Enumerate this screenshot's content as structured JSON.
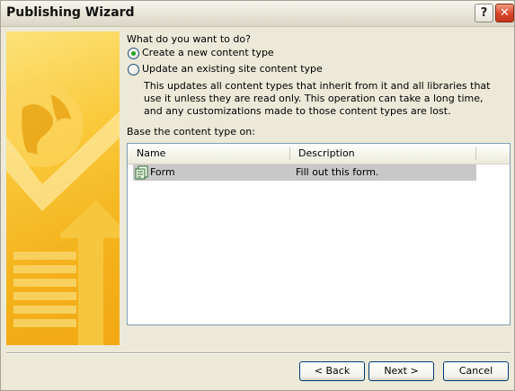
{
  "window": {
    "title": "Publishing Wizard",
    "help_glyph": "?",
    "close_glyph": "✕"
  },
  "question": "What do you want to do?",
  "options": [
    {
      "label": "Create a new content type",
      "checked": true
    },
    {
      "label": "Update an existing site content type",
      "checked": false
    }
  ],
  "update_description": "This updates all content types that inherit from it and all libraries that use it unless they are read only. This operation can take a long time, and any customizations made to those content types are lost.",
  "base_label": "Base the content type on:",
  "list": {
    "columns": [
      "Name",
      "Description"
    ],
    "rows": [
      {
        "name": "Form",
        "description": "Fill out this form.",
        "selected": true,
        "icon": "form-icon"
      }
    ]
  },
  "buttons": {
    "back": "Back",
    "next": "Next >",
    "cancel": "Cancel"
  }
}
